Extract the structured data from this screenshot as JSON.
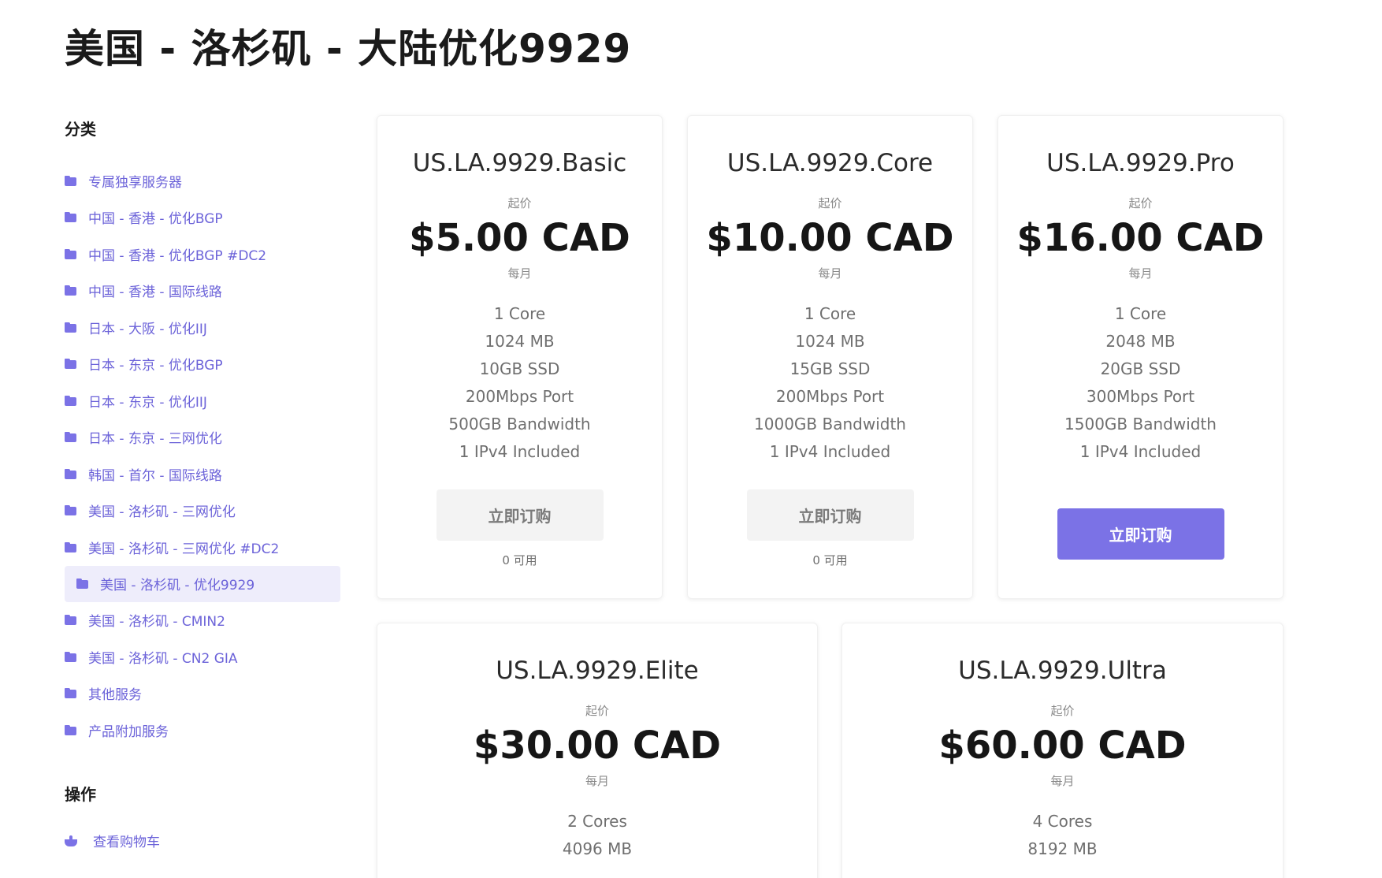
{
  "page": {
    "title": "美国 - 洛杉矶 - 大陆优化9929"
  },
  "sidebar": {
    "categories_heading": "分类",
    "categories": [
      {
        "label": "专属独享服务器",
        "active": false
      },
      {
        "label": "中国 - 香港 - 优化BGP",
        "active": false
      },
      {
        "label": "中国 - 香港 - 优化BGP #DC2",
        "active": false
      },
      {
        "label": "中国 - 香港 - 国际线路",
        "active": false
      },
      {
        "label": "日本 - 大阪 - 优化IIJ",
        "active": false
      },
      {
        "label": "日本 - 东京 - 优化BGP",
        "active": false
      },
      {
        "label": "日本 - 东京 - 优化IIJ",
        "active": false
      },
      {
        "label": "日本 - 东京 - 三网优化",
        "active": false
      },
      {
        "label": "韩国 - 首尔 - 国际线路",
        "active": false
      },
      {
        "label": "美国 - 洛杉矶 - 三网优化",
        "active": false
      },
      {
        "label": "美国 - 洛杉矶 - 三网优化 #DC2",
        "active": false
      },
      {
        "label": "美国 - 洛杉矶 - 优化9929",
        "active": true
      },
      {
        "label": "美国 - 洛杉矶 - CMIN2",
        "active": false
      },
      {
        "label": "美国 - 洛杉矶 - CN2 GIA",
        "active": false
      },
      {
        "label": "其他服务",
        "active": false
      },
      {
        "label": "产品附加服务",
        "active": false
      }
    ],
    "operations_heading": "操作",
    "cart_label": "查看购物车"
  },
  "products": [
    {
      "name": "US.LA.9929.Basic",
      "from_label": "起价",
      "price": "$5.00 CAD",
      "period": "每月",
      "features": [
        "1 Core",
        "1024 MB",
        "10GB SSD",
        "200Mbps Port",
        "500GB Bandwidth",
        "1 IPv4 Included"
      ],
      "button": "立即订购",
      "available": "0 可用",
      "in_stock": false
    },
    {
      "name": "US.LA.9929.Core",
      "from_label": "起价",
      "price": "$10.00 CAD",
      "period": "每月",
      "features": [
        "1 Core",
        "1024 MB",
        "15GB SSD",
        "200Mbps Port",
        "1000GB Bandwidth",
        "1 IPv4 Included"
      ],
      "button": "立即订购",
      "available": "0 可用",
      "in_stock": false
    },
    {
      "name": "US.LA.9929.Pro",
      "from_label": "起价",
      "price": "$16.00 CAD",
      "period": "每月",
      "features": [
        "1 Core",
        "2048 MB",
        "20GB SSD",
        "300Mbps Port",
        "1500GB Bandwidth",
        "1 IPv4 Included"
      ],
      "button": "立即订购",
      "available": "",
      "in_stock": true
    },
    {
      "name": "US.LA.9929.Elite",
      "from_label": "起价",
      "price": "$30.00 CAD",
      "period": "每月",
      "features": [
        "2 Cores",
        "4096 MB"
      ],
      "button": "",
      "available": "",
      "in_stock": true
    },
    {
      "name": "US.LA.9929.Ultra",
      "from_label": "起价",
      "price": "$60.00 CAD",
      "period": "每月",
      "features": [
        "4 Cores",
        "8192 MB"
      ],
      "button": "",
      "available": "",
      "in_stock": true
    }
  ],
  "colors": {
    "accent": "#7b72e6",
    "accent_text": "#6c63d9",
    "active_bg": "#eeedfb"
  }
}
